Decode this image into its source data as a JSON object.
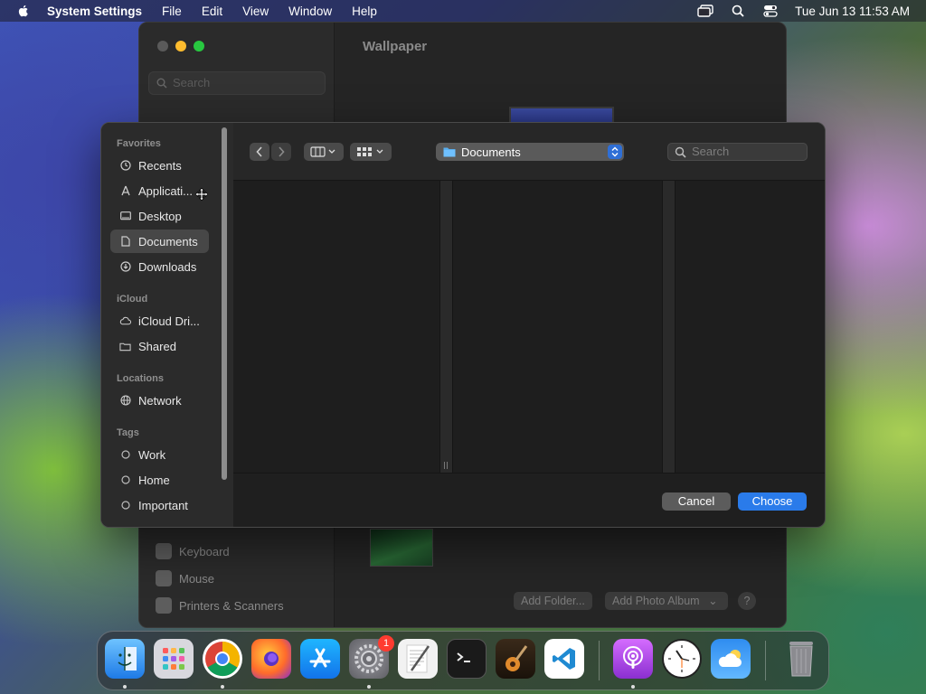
{
  "menubar": {
    "app_name": "System Settings",
    "items": [
      "File",
      "Edit",
      "View",
      "Window",
      "Help"
    ],
    "clock": "Tue Jun 13  11:53 AM"
  },
  "settings_window": {
    "title": "Wallpaper",
    "search_placeholder": "Search",
    "sidebar_items": [
      "Keyboard",
      "Mouse",
      "Printers & Scanners"
    ],
    "add_folder": "Add Folder...",
    "add_photo_album": "Add Photo Album",
    "help": "?"
  },
  "dialog": {
    "sections": {
      "favorites": "Favorites",
      "icloud": "iCloud",
      "locations": "Locations",
      "tags": "Tags"
    },
    "favorites": [
      "Recents",
      "Applicati...",
      "Desktop",
      "Documents",
      "Downloads"
    ],
    "icloud": [
      "iCloud Dri...",
      "Shared"
    ],
    "locations": [
      "Network"
    ],
    "tags": [
      "Work",
      "Home",
      "Important"
    ],
    "selected": "Documents",
    "path": "Documents",
    "search_placeholder": "Search",
    "cancel": "Cancel",
    "choose": "Choose"
  },
  "dock": {
    "badge_settings": "1"
  },
  "colors": {
    "accent": "#2a7bea",
    "close": "#5a5a5a",
    "minimize": "#febc2e",
    "maximize": "#28c840"
  }
}
